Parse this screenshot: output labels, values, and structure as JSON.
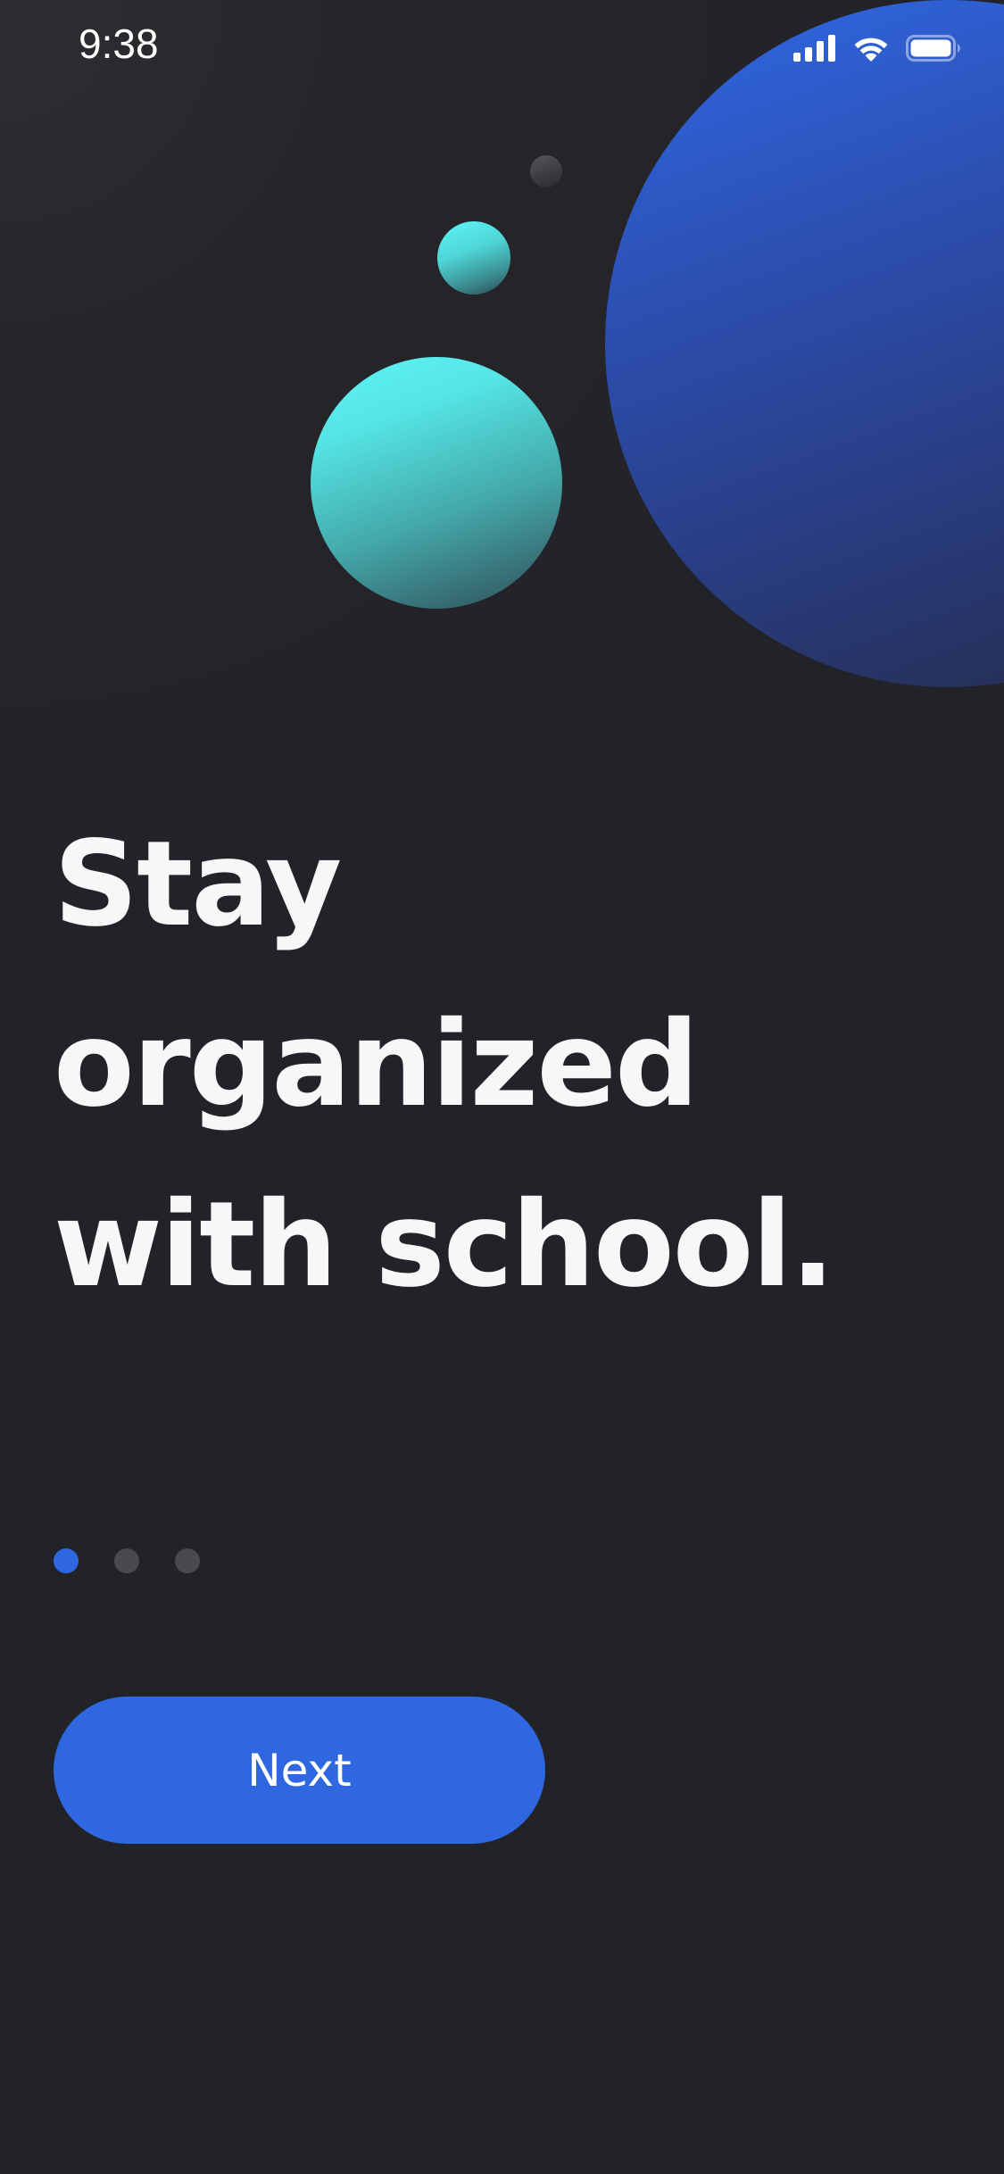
{
  "status_bar": {
    "time": "9:38",
    "icons": [
      "signal-icon",
      "wifi-icon",
      "battery-icon"
    ]
  },
  "onboarding": {
    "headline_lines": [
      "Stay",
      "organized",
      "with school."
    ],
    "pagination": {
      "total": 3,
      "current": 1
    },
    "next_label": "Next"
  },
  "colors": {
    "background": "#222229",
    "accent": "#2f67e0",
    "teal": "#5ff4f5",
    "text": "#f7f7f8",
    "inactive_dot": "#49494f"
  }
}
